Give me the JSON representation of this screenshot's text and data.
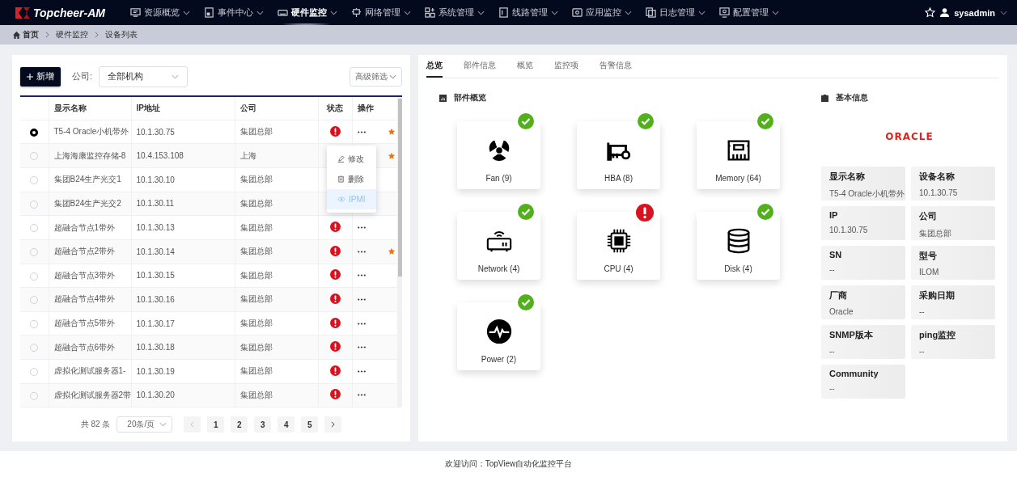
{
  "header": {
    "logo": "Topcheer-AM",
    "nav": [
      {
        "label": "资源概览",
        "selected": false
      },
      {
        "label": "事件中心",
        "selected": false
      },
      {
        "label": "硬件监控",
        "selected": true
      },
      {
        "label": "网络管理",
        "selected": false
      },
      {
        "label": "系统管理",
        "selected": false
      },
      {
        "label": "线路管理",
        "selected": false
      },
      {
        "label": "应用监控",
        "selected": false
      },
      {
        "label": "日志管理",
        "selected": false
      },
      {
        "label": "配置管理",
        "selected": false
      }
    ],
    "user": "sysadmin"
  },
  "breadcrumb": [
    "首页",
    "硬件监控",
    "设备列表"
  ],
  "device_list": {
    "add_button": "新增",
    "company_label": "公司:",
    "company_value": "全部机构",
    "filter_button": "高级筛选",
    "columns": [
      "显示名称",
      "IP地址",
      "公司",
      "状态",
      "操作"
    ],
    "rows": [
      {
        "name": "T5-4 Oracle小机带外",
        "ip": "10.1.30.75",
        "company": "集团总部",
        "selected": true,
        "alert": true,
        "actions": true,
        "starred": true
      },
      {
        "name": "上海海康监控存储-8",
        "ip": "10.4.153.108",
        "company": "上海",
        "selected": false,
        "alert": false,
        "actions": false,
        "starred": true
      },
      {
        "name": "集团B24生产光交1",
        "ip": "10.1.30.10",
        "company": "集团总部",
        "selected": false,
        "alert": false,
        "actions": false,
        "starred": false
      },
      {
        "name": "集团B24生产光交2",
        "ip": "10.1.30.11",
        "company": "集团总部",
        "selected": false,
        "alert": false,
        "actions": false,
        "starred": false
      },
      {
        "name": "超融合节点1带外",
        "ip": "10.1.30.13",
        "company": "集团总部",
        "selected": false,
        "alert": true,
        "actions": true,
        "starred": false
      },
      {
        "name": "超融合节点2带外",
        "ip": "10.1.30.14",
        "company": "集团总部",
        "selected": false,
        "alert": true,
        "actions": true,
        "starred": true
      },
      {
        "name": "超融合节点3带外",
        "ip": "10.1.30.15",
        "company": "集团总部",
        "selected": false,
        "alert": true,
        "actions": true,
        "starred": false
      },
      {
        "name": "超融合节点4带外",
        "ip": "10.1.30.16",
        "company": "集团总部",
        "selected": false,
        "alert": true,
        "actions": true,
        "starred": false
      },
      {
        "name": "超融合节点5带外",
        "ip": "10.1.30.17",
        "company": "集团总部",
        "selected": false,
        "alert": true,
        "actions": true,
        "starred": false
      },
      {
        "name": "超融合节点6带外",
        "ip": "10.1.30.18",
        "company": "集团总部",
        "selected": false,
        "alert": true,
        "actions": true,
        "starred": false
      },
      {
        "name": "虚拟化测试服务器1-",
        "ip": "10.1.30.19",
        "company": "集团总部",
        "selected": false,
        "alert": true,
        "actions": true,
        "starred": false
      },
      {
        "name": "虚拟化测试服务器2带",
        "ip": "10.1.30.20",
        "company": "集团总部",
        "selected": false,
        "alert": true,
        "actions": true,
        "starred": false
      }
    ],
    "row_menu": [
      {
        "label": "修改",
        "selected": false
      },
      {
        "label": "删除",
        "selected": false
      },
      {
        "label": "IPMI",
        "selected": true
      }
    ],
    "pagination": {
      "total": "共 82 条",
      "page_size": "20条/页",
      "pages": [
        "1",
        "2",
        "3",
        "4",
        "5"
      ]
    }
  },
  "detail": {
    "tabs": [
      {
        "label": "总览",
        "selected": true
      },
      {
        "label": "部件信息",
        "selected": false
      },
      {
        "label": "概览",
        "selected": false
      },
      {
        "label": "监控项",
        "selected": false
      },
      {
        "label": "告警信息",
        "selected": false
      }
    ],
    "components_title": "部件概览",
    "components": [
      {
        "kind": "fan",
        "label": "Fan (9)",
        "alert": false
      },
      {
        "kind": "hba",
        "label": "HBA (8)",
        "alert": false
      },
      {
        "kind": "memory",
        "label": "Memory (64)",
        "alert": false
      },
      {
        "kind": "network",
        "label": "Network (4)",
        "alert": false
      },
      {
        "kind": "cpu",
        "label": "CPU (4)",
        "alert": true
      },
      {
        "kind": "disk",
        "label": "Disk (4)",
        "alert": false
      },
      {
        "kind": "power",
        "label": "Power (2)",
        "alert": false
      }
    ],
    "info_title": "基本信息",
    "vendor_logo": "ORACLE",
    "info": [
      {
        "label": "显示名称",
        "value": "T5-4 Oracle小机带外"
      },
      {
        "label": "设备名称",
        "value": "10.1.30.75"
      },
      {
        "label": "IP",
        "value": "10.1.30.75"
      },
      {
        "label": "公司",
        "value": "集团总部"
      },
      {
        "label": "SN",
        "value": "--"
      },
      {
        "label": "型号",
        "value": "ILOM"
      },
      {
        "label": "厂商",
        "value": "Oracle"
      },
      {
        "label": "采购日期",
        "value": "--"
      },
      {
        "label": "SNMP版本",
        "value": "--"
      },
      {
        "label": "ping监控",
        "value": "--"
      },
      {
        "label": "Community",
        "value": "--"
      }
    ]
  },
  "footer": "欢迎访问：TopView自动化监控平台"
}
